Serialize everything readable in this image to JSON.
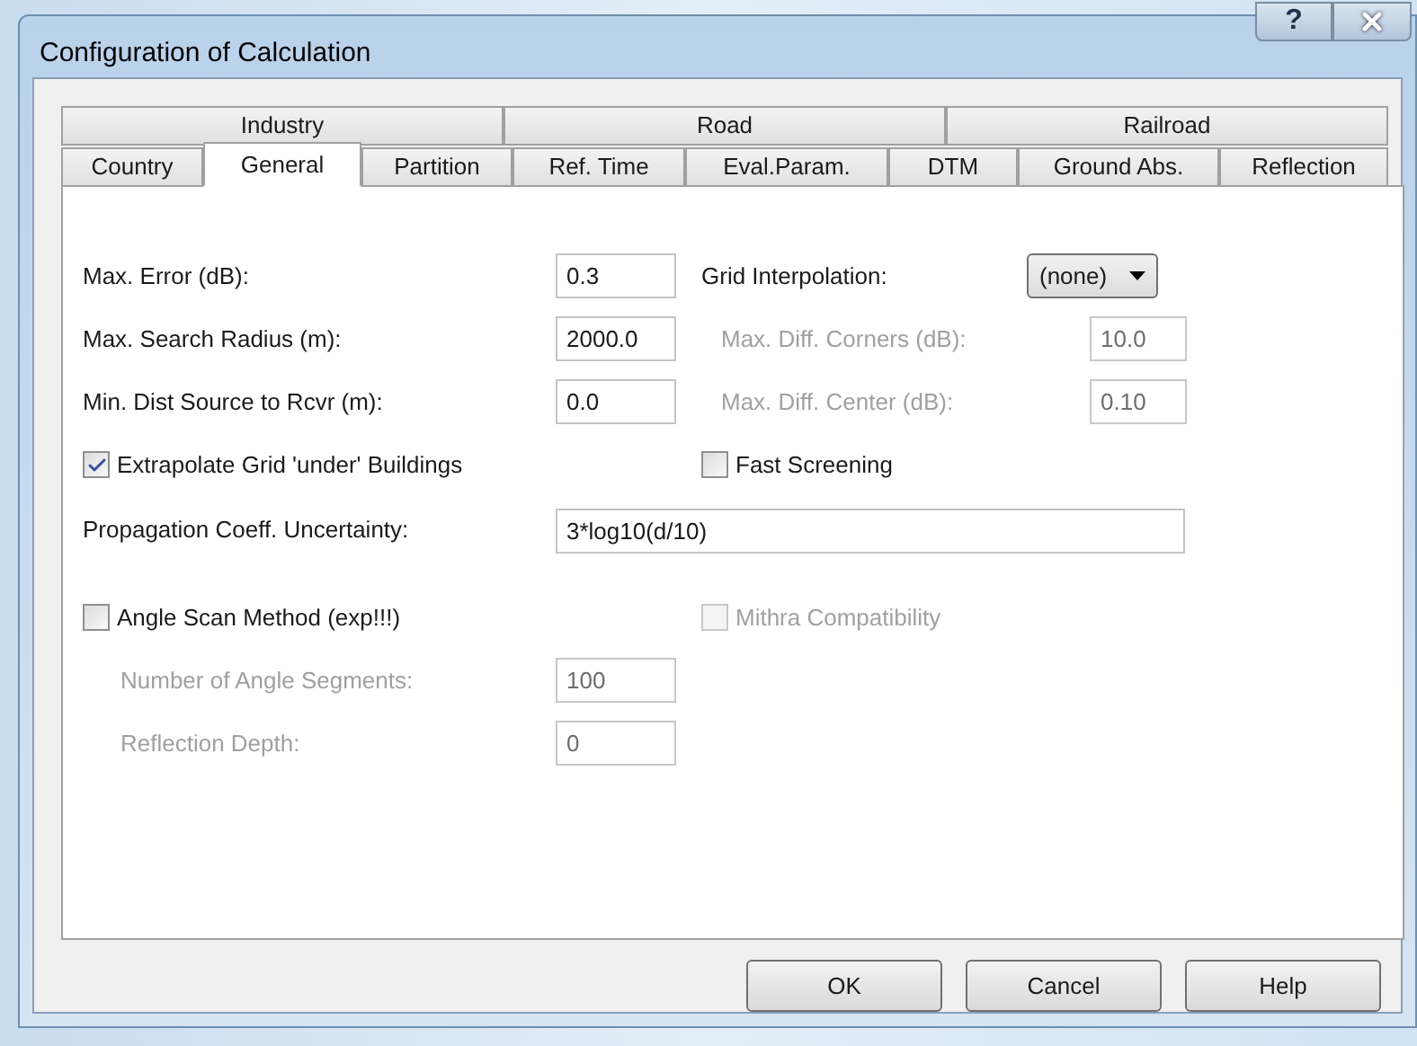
{
  "window": {
    "title": "Configuration of Calculation",
    "help_button": "?"
  },
  "tab_rows": [
    [
      {
        "label": "Industry",
        "selected": false
      },
      {
        "label": "Road",
        "selected": false
      },
      {
        "label": "Railroad",
        "selected": false
      }
    ],
    [
      {
        "label": "Country",
        "selected": false
      },
      {
        "label": "General",
        "selected": true
      },
      {
        "label": "Partition",
        "selected": false
      },
      {
        "label": "Ref. Time",
        "selected": false
      },
      {
        "label": "Eval.Param.",
        "selected": false
      },
      {
        "label": "DTM",
        "selected": false
      },
      {
        "label": "Ground Abs.",
        "selected": false
      },
      {
        "label": "Reflection",
        "selected": false
      }
    ]
  ],
  "general_rows": [
    {
      "kind": "pair",
      "left": {
        "label": "Max. Error (dB):",
        "value": "0.3",
        "disabled": false
      },
      "right": {
        "kind": "select",
        "label": "Grid Interpolation:",
        "value": "(none)"
      }
    },
    {
      "kind": "pair",
      "left": {
        "label": "Max. Search Radius (m):",
        "value": "2000.0",
        "disabled": false
      },
      "right": {
        "kind": "field",
        "label": "Max. Diff. Corners (dB):",
        "value": "10.0",
        "disabled": true
      }
    },
    {
      "kind": "pair",
      "left": {
        "label": "Min. Dist Source to Rcvr (m):",
        "value": "0.0",
        "disabled": false
      },
      "right": {
        "kind": "field",
        "label": "Max. Diff. Center (dB):",
        "value": "0.10",
        "disabled": true
      }
    },
    {
      "kind": "checks",
      "left": {
        "label": "Extrapolate Grid 'under' Buildings",
        "checked": true,
        "disabled": false
      },
      "right": {
        "label": "Fast Screening",
        "checked": false,
        "disabled": false
      }
    },
    {
      "kind": "wide",
      "label": "Propagation Coeff. Uncertainty:",
      "value": "3*log10(d/10)"
    }
  ],
  "angle_rows": [
    {
      "kind": "checks",
      "left": {
        "label": "Angle Scan Method (exp!!!)",
        "checked": false,
        "disabled": false
      },
      "right": {
        "label": "Mithra Compatibility",
        "checked": false,
        "disabled": true
      }
    },
    {
      "kind": "sub",
      "label": "Number of Angle Segments:",
      "value": "100",
      "disabled": true
    },
    {
      "kind": "sub",
      "label": "Reflection Depth:",
      "value": "0",
      "disabled": true
    }
  ],
  "buttons": [
    "OK",
    "Cancel",
    "Help"
  ]
}
